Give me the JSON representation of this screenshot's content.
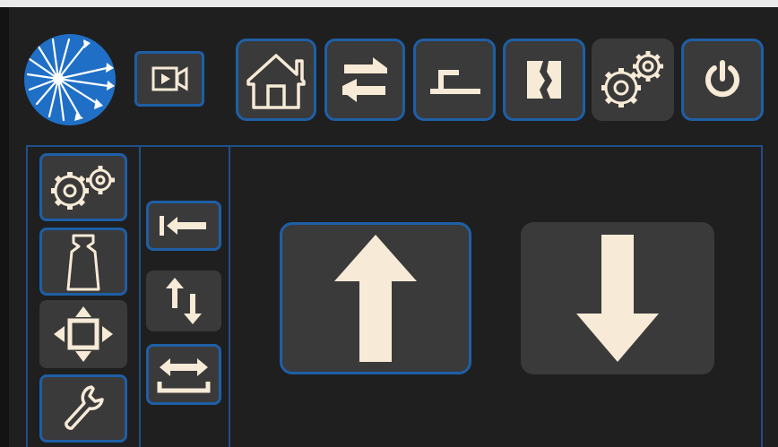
{
  "app": {
    "title": ""
  },
  "colors": {
    "background": "#1f1f1f",
    "button_bg": "#3a3a3a",
    "accent_border": "#1e5fa6",
    "icon": "#f7ead6",
    "logo_blue": "#1f6fc6"
  },
  "header": {
    "logo": {
      "icon": "starburst-logo-icon"
    },
    "camera_button": {
      "icon": "video-camera-icon"
    },
    "nav": [
      {
        "id": "home",
        "icon": "home-icon",
        "selected": false
      },
      {
        "id": "swap",
        "icon": "swap-arrows-icon",
        "selected": false
      },
      {
        "id": "threading",
        "icon": "hook-bar-icon",
        "selected": false
      },
      {
        "id": "splice",
        "icon": "split-block-icon",
        "selected": false
      },
      {
        "id": "settings",
        "icon": "gears-icon",
        "selected": true
      },
      {
        "id": "power",
        "icon": "power-icon",
        "selected": false
      }
    ]
  },
  "side_menu": [
    {
      "id": "gears",
      "icon": "gears-icon",
      "selected": true
    },
    {
      "id": "weight",
      "icon": "weight-icon",
      "selected": false
    },
    {
      "id": "move",
      "icon": "move-arrows-icon",
      "selected": false
    },
    {
      "id": "tools",
      "icon": "wrench-icon",
      "selected": true
    }
  ],
  "sub_menu": [
    {
      "id": "to-start",
      "icon": "arrow-left-bar-icon",
      "selected": true
    },
    {
      "id": "up-down",
      "icon": "up-down-arrows-icon",
      "selected": false
    },
    {
      "id": "width",
      "icon": "horizontal-width-icon",
      "selected": true
    }
  ],
  "main": {
    "up_button": {
      "icon": "arrow-up-icon",
      "selected": true
    },
    "down_button": {
      "icon": "arrow-down-icon",
      "selected": false
    }
  }
}
